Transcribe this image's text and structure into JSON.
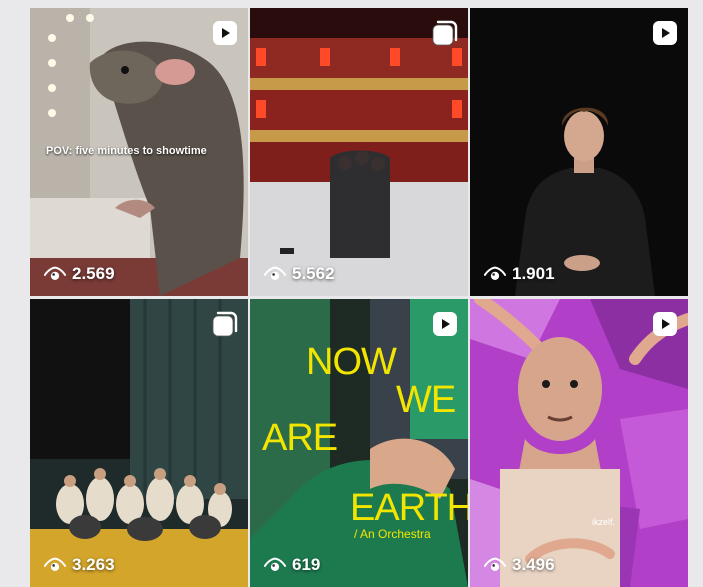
{
  "grid": {
    "tiles": [
      {
        "type": "video",
        "caption": "POV: five minutes to showtime",
        "views": "2.569"
      },
      {
        "type": "carousel",
        "views": "5.562"
      },
      {
        "type": "video",
        "views": "1.901"
      },
      {
        "type": "carousel",
        "views": "3.263"
      },
      {
        "type": "video",
        "views": "619",
        "poster": {
          "line1": "NOW",
          "line2": "WE",
          "line3": "ARE",
          "line4": "EARTH",
          "subtitle": "/ An Orchestra"
        }
      },
      {
        "type": "video",
        "views": "3.496",
        "signature": "ikzelf."
      }
    ]
  },
  "icons": {
    "views": "eye-icon",
    "video": "reel-icon",
    "carousel": "carousel-icon"
  },
  "colors": {
    "poster_text": "#f2e600",
    "overlay_text": "#ffffff",
    "page_bg": "#e9e9ec"
  }
}
